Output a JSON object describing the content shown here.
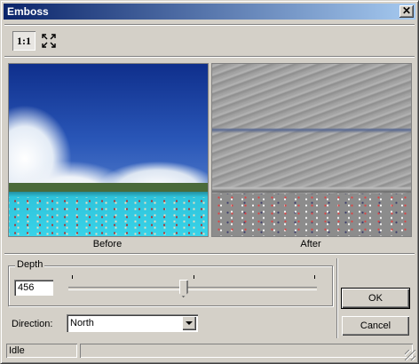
{
  "window": {
    "title": "Emboss",
    "close_glyph": "✕"
  },
  "toolbar": {
    "actual_size_label": "1:1",
    "fit_icon": "expand-arrows-icon"
  },
  "preview": {
    "before_caption": "Before",
    "after_caption": "After"
  },
  "depth": {
    "group_label": "Depth",
    "value": "456",
    "slider_fraction": 0.46
  },
  "direction": {
    "label": "Direction:",
    "selected": "North"
  },
  "buttons": {
    "ok": "OK",
    "cancel": "Cancel"
  },
  "status": {
    "text": "Idle"
  },
  "colors": {
    "title_start": "#0a246a",
    "title_end": "#a6caf0",
    "face": "#d4d0c8"
  }
}
